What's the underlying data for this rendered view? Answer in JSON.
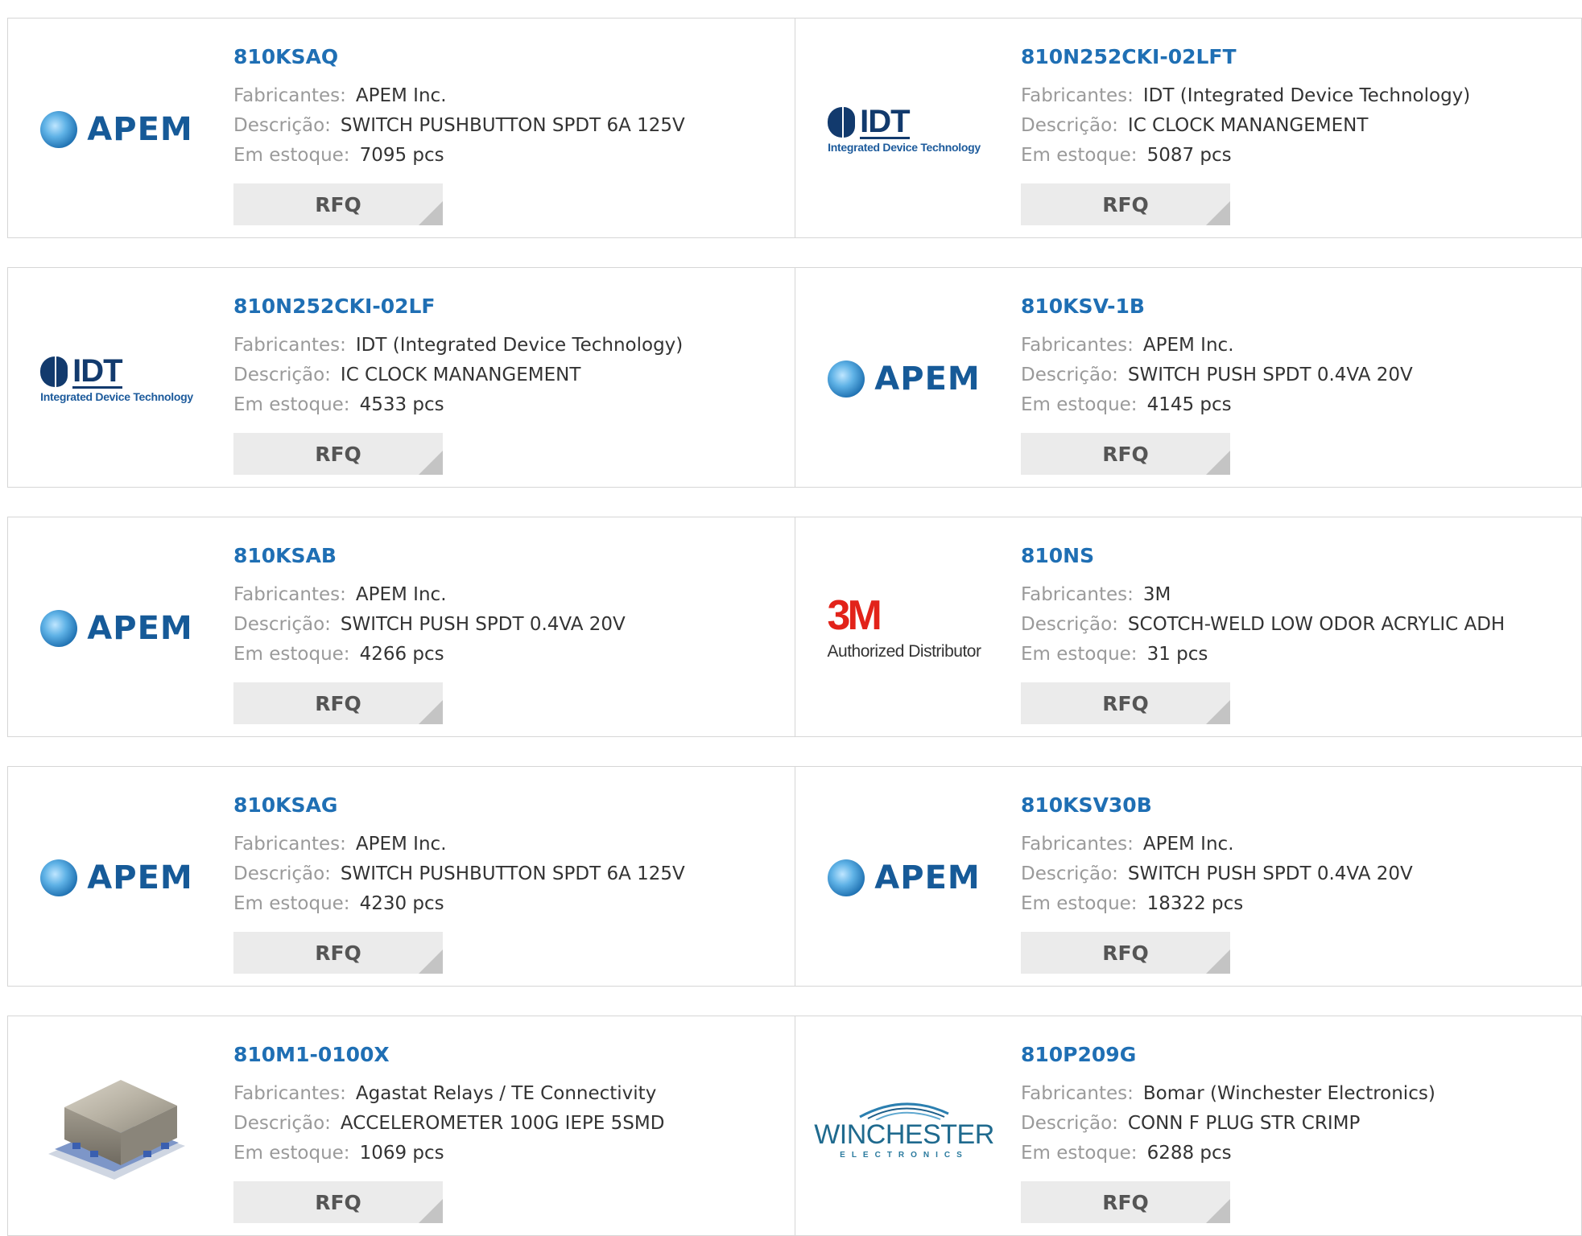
{
  "labels": {
    "manufacturer": "Fabricantes:",
    "description": "Descrição:",
    "stock": "Em estoque:",
    "rfq": "RFQ"
  },
  "logos": {
    "apem_text": "APEM",
    "idt_text": "IDT",
    "idt_sub": "Integrated Device Technology",
    "three_m_text": "3M",
    "three_m_sub": "Authorized Distributor",
    "winchester_text": "WINCHESTER",
    "winchester_sub": "ELECTRONICS"
  },
  "products": [
    {
      "part": "810KSAQ",
      "manufacturer": "APEM Inc.",
      "description": "SWITCH PUSHBUTTON SPDT 6A 125V",
      "stock": "7095 pcs",
      "logo": "apem"
    },
    {
      "part": "810N252CKI-02LFT",
      "manufacturer": "IDT (Integrated Device Technology)",
      "description": "IC CLOCK MANANGEMENT",
      "stock": "5087 pcs",
      "logo": "idt"
    },
    {
      "part": "810N252CKI-02LF",
      "manufacturer": "IDT (Integrated Device Technology)",
      "description": "IC CLOCK MANANGEMENT",
      "stock": "4533 pcs",
      "logo": "idt"
    },
    {
      "part": "810KSV-1B",
      "manufacturer": "APEM Inc.",
      "description": "SWITCH PUSH SPDT 0.4VA 20V",
      "stock": "4145 pcs",
      "logo": "apem"
    },
    {
      "part": "810KSAB",
      "manufacturer": "APEM Inc.",
      "description": "SWITCH PUSH SPDT 0.4VA 20V",
      "stock": "4266 pcs",
      "logo": "apem"
    },
    {
      "part": "810NS",
      "manufacturer": "3M",
      "description": "SCOTCH-WELD LOW ODOR ACRYLIC ADH",
      "stock": "31 pcs",
      "logo": "3m"
    },
    {
      "part": "810KSAG",
      "manufacturer": "APEM Inc.",
      "description": "SWITCH PUSHBUTTON SPDT 6A 125V",
      "stock": "4230 pcs",
      "logo": "apem"
    },
    {
      "part": "810KSV30B",
      "manufacturer": "APEM Inc.",
      "description": "SWITCH PUSH SPDT 0.4VA 20V",
      "stock": "18322 pcs",
      "logo": "apem"
    },
    {
      "part": "810M1-0100X",
      "manufacturer": "Agastat Relays / TE Connectivity",
      "description": "ACCELEROMETER 100G IEPE 5SMD",
      "stock": "1069 pcs",
      "logo": "accelerometer-photo"
    },
    {
      "part": "810P209G",
      "manufacturer": "Bomar (Winchester Electronics)",
      "description": "CONN F PLUG STR CRIMP",
      "stock": "6288 pcs",
      "logo": "winchester"
    }
  ]
}
